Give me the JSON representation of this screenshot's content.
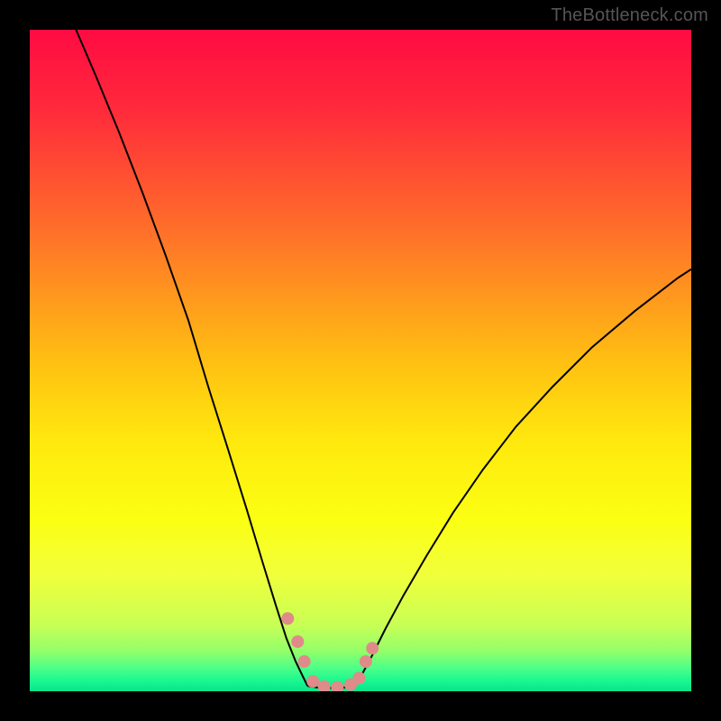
{
  "watermark": "TheBottleneck.com",
  "chart_data": {
    "type": "line",
    "title": "",
    "xlabel": "",
    "ylabel": "",
    "xlim": [
      0,
      100
    ],
    "ylim": [
      0,
      100
    ],
    "grid": false,
    "legend": false,
    "annotations": [],
    "background_gradient": {
      "stops": [
        {
          "pos": 0.0,
          "color": "#ff0b42"
        },
        {
          "pos": 0.12,
          "color": "#ff2a3b"
        },
        {
          "pos": 0.3,
          "color": "#ff6e2a"
        },
        {
          "pos": 0.5,
          "color": "#ffbf12"
        },
        {
          "pos": 0.62,
          "color": "#ffe80e"
        },
        {
          "pos": 0.74,
          "color": "#fbff12"
        },
        {
          "pos": 0.82,
          "color": "#f2ff3a"
        },
        {
          "pos": 0.9,
          "color": "#c8ff55"
        },
        {
          "pos": 0.94,
          "color": "#92ff6a"
        },
        {
          "pos": 0.965,
          "color": "#4dff88"
        },
        {
          "pos": 0.985,
          "color": "#18f790"
        },
        {
          "pos": 1.0,
          "color": "#0be28c"
        }
      ]
    },
    "series": [
      {
        "name": "left-arm",
        "color": "#000000",
        "width": 2,
        "x": [
          7.0,
          10.0,
          13.5,
          17.0,
          20.5,
          24.0,
          27.0,
          30.0,
          32.8,
          35.2,
          37.2,
          38.8,
          40.2,
          41.3,
          42.0
        ],
        "y": [
          100.0,
          93.0,
          84.5,
          75.5,
          66.0,
          56.0,
          46.0,
          36.5,
          27.5,
          19.5,
          13.0,
          8.0,
          4.5,
          2.2,
          0.8
        ]
      },
      {
        "name": "right-arm",
        "color": "#000000",
        "width": 2,
        "x": [
          49.0,
          50.2,
          51.8,
          53.8,
          56.5,
          60.0,
          64.0,
          68.5,
          73.5,
          79.0,
          85.0,
          91.5,
          98.0,
          100.0
        ],
        "y": [
          0.8,
          2.5,
          5.5,
          9.5,
          14.5,
          20.5,
          27.0,
          33.5,
          40.0,
          46.0,
          52.0,
          57.5,
          62.5,
          63.8
        ]
      },
      {
        "name": "bottom-flat",
        "color": "#000000",
        "width": 2,
        "x": [
          42.0,
          44.0,
          46.0,
          48.0,
          49.0
        ],
        "y": [
          0.8,
          0.5,
          0.5,
          0.6,
          0.8
        ]
      }
    ],
    "markers": [
      {
        "name": "left-cluster",
        "color": "#e08a8a",
        "size": 14,
        "points": [
          [
            40.5,
            7.5
          ],
          [
            39.0,
            11.0
          ],
          [
            41.5,
            4.5
          ],
          [
            42.8,
            1.5
          ],
          [
            44.5,
            0.7
          ],
          [
            46.5,
            0.6
          ],
          [
            48.5,
            1.0
          ]
        ]
      },
      {
        "name": "right-cluster",
        "color": "#e08a8a",
        "size": 14,
        "points": [
          [
            49.8,
            2.0
          ],
          [
            50.8,
            4.5
          ],
          [
            51.8,
            6.5
          ]
        ]
      }
    ]
  }
}
